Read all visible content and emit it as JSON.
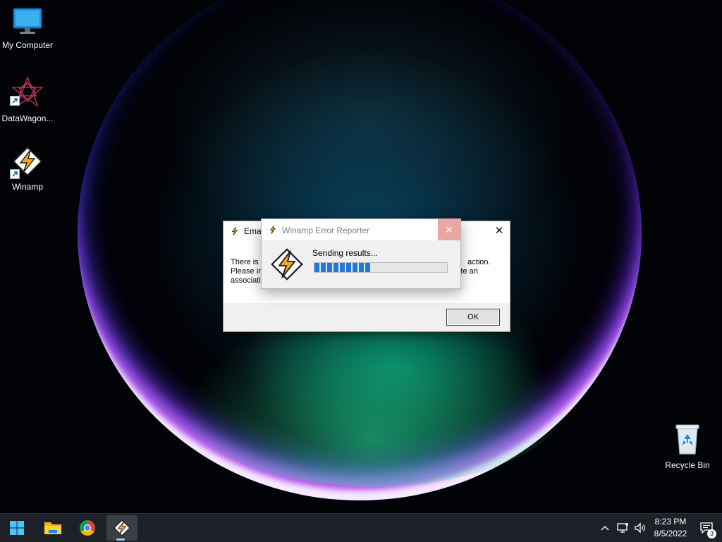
{
  "desktop": {
    "icons": [
      {
        "label": "My Computer",
        "icon": "monitor-icon"
      },
      {
        "label": "DataWagon...",
        "icon": "datawagon-icon"
      },
      {
        "label": "Winamp",
        "icon": "winamp-icon"
      },
      {
        "label": "Recycle Bin",
        "icon": "recycle-bin-icon"
      }
    ]
  },
  "email_dialog": {
    "title": "Emai",
    "body_lines": [
      "There is                                                                                                 action.",
      "Please in                                                                                        eate an",
      "associati"
    ],
    "ok_label": "OK",
    "close_symbol": "✕"
  },
  "error_reporter": {
    "title": "Winamp Error Reporter",
    "status": "Sending results...",
    "progress": 0.43,
    "close_symbol": "✕"
  },
  "taskbar": {
    "items": [
      "start-icon",
      "file-explorer-icon",
      "chrome-icon",
      "winamp-icon"
    ],
    "tray": {
      "time": "8:23 PM",
      "date": "8/5/2022",
      "notification_count": "3"
    }
  },
  "colors": {
    "progress_fill": "#1f79d8",
    "taskbar": "#1d2027",
    "reporter_close": "#eaa5a5"
  }
}
